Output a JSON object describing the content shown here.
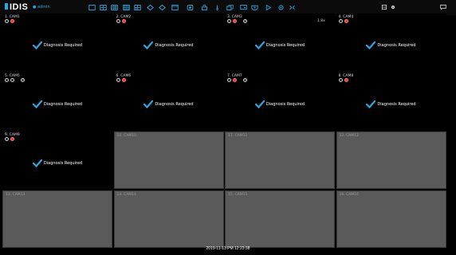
{
  "app": {
    "logo": "IDIS",
    "user": "admin"
  },
  "toolbar": [
    {
      "icon": "layout-1x1-icon"
    },
    {
      "icon": "layout-2x2-icon"
    },
    {
      "icon": "layout-3x3-icon"
    },
    {
      "icon": "layout-4x4-icon"
    },
    {
      "icon": "layout-custom-icon"
    },
    {
      "icon": "sequence-icon"
    },
    {
      "icon": "camera-group-icon"
    },
    {
      "icon": "fullscreen-icon"
    },
    {
      "icon": "record-icon"
    },
    {
      "icon": "lock-icon"
    },
    {
      "icon": "alarm-out-icon"
    },
    {
      "icon": "copy-icon"
    },
    {
      "icon": "monitor-icon"
    },
    {
      "icon": "ptz-icon"
    },
    {
      "icon": "play-icon"
    },
    {
      "icon": "setup-icon"
    },
    {
      "icon": "network-icon"
    }
  ],
  "right_icons": [
    {
      "icon": "storage-icon"
    },
    {
      "icon": "gear-icon"
    },
    {
      "icon": "message-icon"
    }
  ],
  "colors": {
    "accent": "#28a8e0",
    "status_red": "#e33333",
    "check": "#2aa7e0",
    "empty_cell": "#5a5a5a"
  },
  "diagnosis_text": "Diagnosis Required",
  "cameras": [
    {
      "label": "1. CAM1",
      "badges": [
        "g",
        "r"
      ],
      "p": false,
      "speed": "",
      "diag": true
    },
    {
      "label": "2. CAM2",
      "badges": [
        "g",
        "r"
      ],
      "p": false,
      "speed": "",
      "diag": true
    },
    {
      "label": "3. CAM3",
      "badges": [
        "g",
        "r"
      ],
      "p": true,
      "speed": "1.8x",
      "diag": true
    },
    {
      "label": "4. CAM4",
      "badges": [
        "g",
        "r"
      ],
      "p": false,
      "speed": "",
      "diag": true
    },
    {
      "label": "5. CAM5",
      "badges": [
        "g",
        "g"
      ],
      "p": true,
      "speed": "",
      "diag": true
    },
    {
      "label": "6. CAM6",
      "badges": [
        "g",
        "r"
      ],
      "p": false,
      "speed": "",
      "diag": true
    },
    {
      "label": "7. CAM7",
      "badges": [
        "g",
        "r"
      ],
      "p": true,
      "speed": "",
      "diag": true
    },
    {
      "label": "8. CAM8",
      "badges": [
        "g",
        "r"
      ],
      "p": false,
      "speed": "",
      "diag": true
    },
    {
      "label": "9. CAM9",
      "badges": [
        "g",
        "r"
      ],
      "p": false,
      "speed": "",
      "diag": true
    },
    {
      "label": "10. CAM10",
      "badges": [],
      "p": false,
      "speed": "",
      "diag": false
    },
    {
      "label": "11. CAM11",
      "badges": [],
      "p": false,
      "speed": "",
      "diag": false
    },
    {
      "label": "12. CAM12",
      "badges": [],
      "p": false,
      "speed": "",
      "diag": false
    },
    {
      "label": "13. CAM13",
      "badges": [],
      "p": false,
      "speed": "",
      "diag": false
    },
    {
      "label": "14. CAM14",
      "badges": [],
      "p": false,
      "speed": "",
      "diag": false
    },
    {
      "label": "15. CAM15",
      "badges": [],
      "p": false,
      "speed": "",
      "diag": false
    },
    {
      "label": "16. CAM16",
      "badges": [],
      "p": false,
      "speed": "",
      "diag": false
    }
  ],
  "status": {
    "datetime": "2019-11-13 PM 12:23:38"
  }
}
